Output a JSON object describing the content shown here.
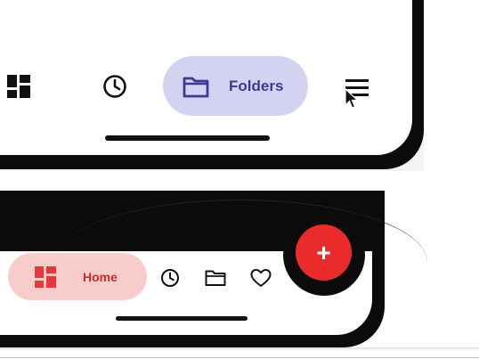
{
  "top_nav": {
    "theme_color": "#3d3895",
    "pill_color": "#d4d2f1",
    "items": [
      {
        "icon": "dashboard-icon"
      },
      {
        "icon": "history-icon"
      },
      {
        "icon": "folder-icon",
        "label": "Folders",
        "active": true
      },
      {
        "icon": "menu-icon"
      }
    ]
  },
  "bottom_nav": {
    "theme_color": "#ea2b2b",
    "pill_color": "#f9cccc",
    "fab_label": "+",
    "items": [
      {
        "icon": "dashboard-icon",
        "label": "Home",
        "active": true
      },
      {
        "icon": "history-icon"
      },
      {
        "icon": "folder-icon"
      },
      {
        "icon": "heart-icon"
      }
    ]
  }
}
